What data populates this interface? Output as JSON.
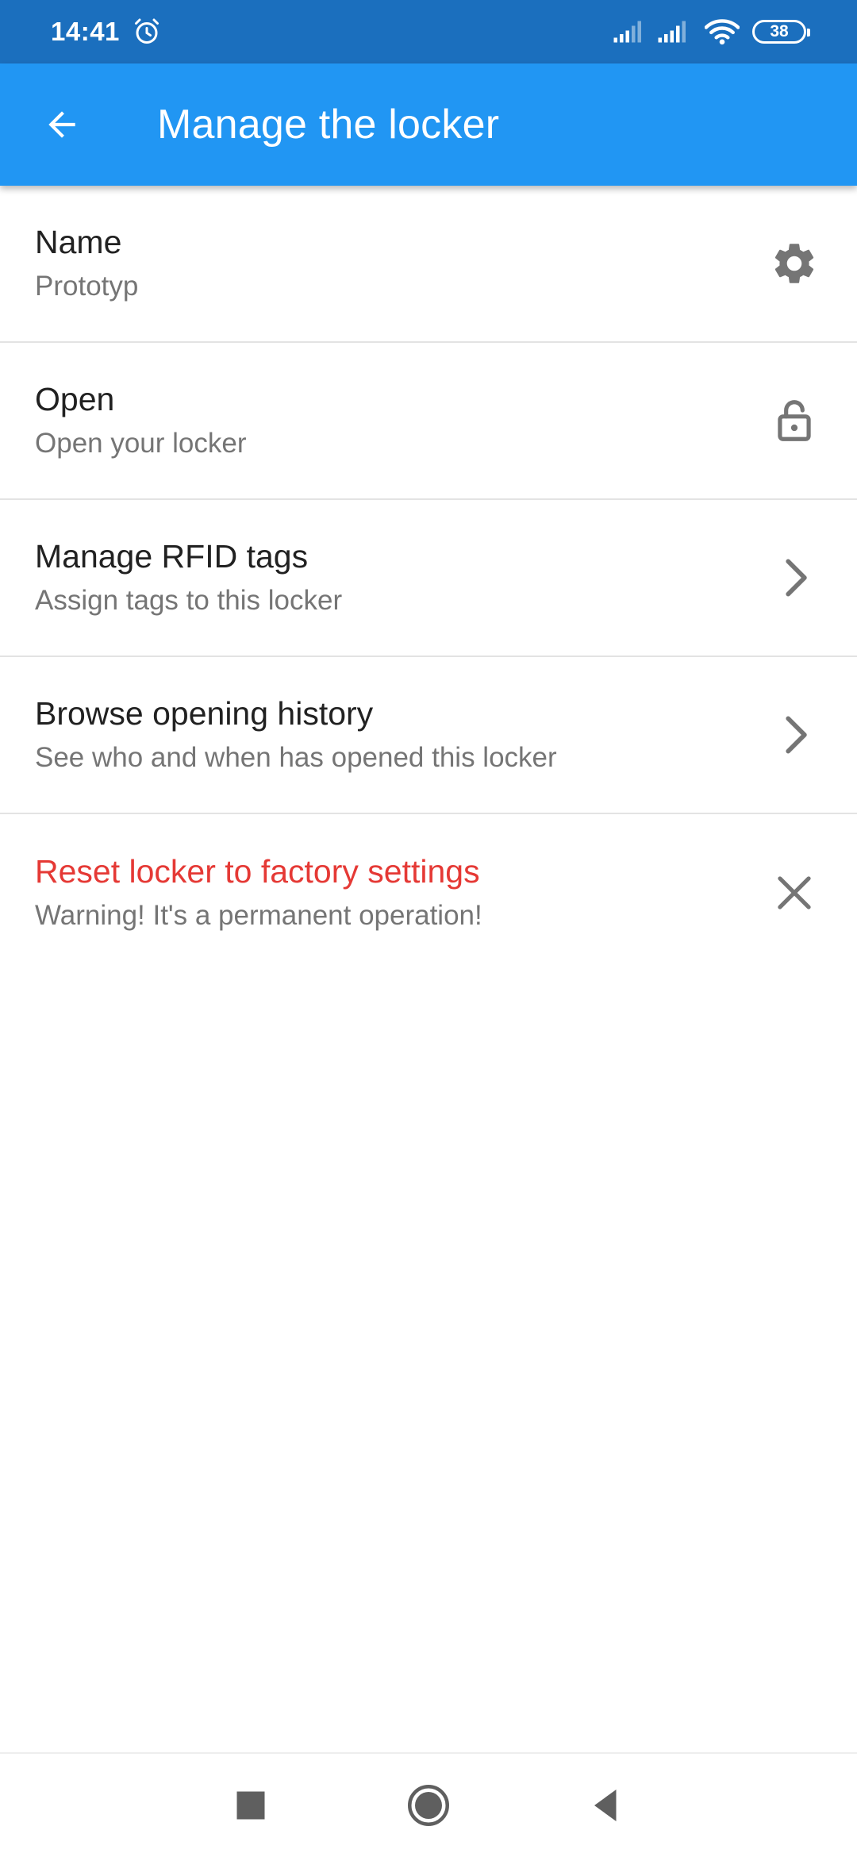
{
  "status_bar": {
    "time": "14:41",
    "battery": "38",
    "icons": [
      "alarm-icon",
      "signal-icon",
      "signal-icon",
      "wifi-icon",
      "battery-icon"
    ]
  },
  "app_bar": {
    "title": "Manage the locker",
    "back_icon": "arrow-left-icon",
    "background": "#2196f3"
  },
  "items": [
    {
      "title": "Name",
      "subtitle": "Prototyp",
      "icon": "gear-icon"
    },
    {
      "title": "Open",
      "subtitle": "Open your locker",
      "icon": "unlock-icon"
    },
    {
      "title": "Manage RFID tags",
      "subtitle": "Assign tags to this locker",
      "icon": "chevron-right-icon"
    },
    {
      "title": "Browse opening history",
      "subtitle": "See who and when has opened this locker",
      "icon": "chevron-right-icon"
    },
    {
      "title": "Reset locker to factory settings",
      "subtitle": "Warning! It's a permanent operation!",
      "icon": "close-icon",
      "title_color": "#e53935"
    }
  ],
  "nav_bar": {
    "icons": [
      "recents-square-icon",
      "home-circle-icon",
      "back-triangle-icon"
    ]
  }
}
